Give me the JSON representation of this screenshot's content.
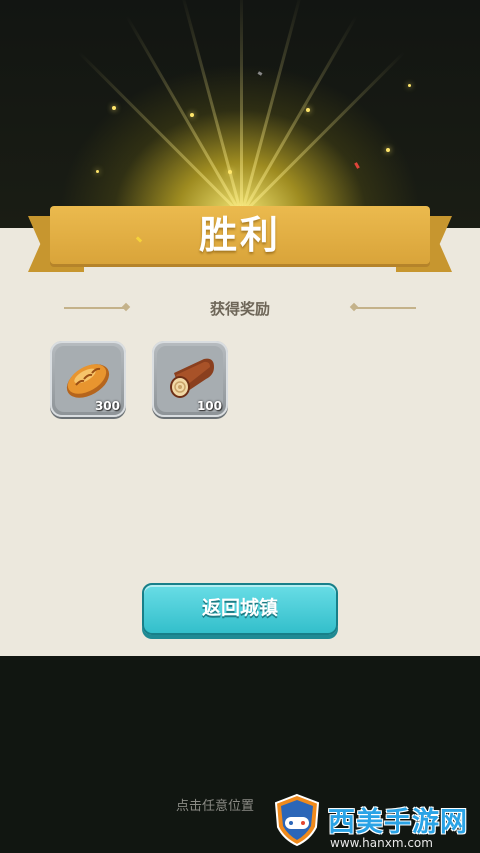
{
  "banner": {
    "title": "胜利"
  },
  "rewards_section": {
    "title": "获得奖励",
    "items": [
      {
        "icon": "bread-icon",
        "quantity": "300"
      },
      {
        "icon": "wood-log-icon",
        "quantity": "100"
      }
    ]
  },
  "actions": {
    "return_label": "返回城镇"
  },
  "footer": {
    "hint": "点击任意位置"
  },
  "watermark": {
    "brand": "西美手游网",
    "url": "www.hanxm.com"
  },
  "colors": {
    "ribbon": "#e3b044",
    "button": "#45cdd8",
    "panel": "#ece8dd",
    "glow": "#ffe66b"
  }
}
